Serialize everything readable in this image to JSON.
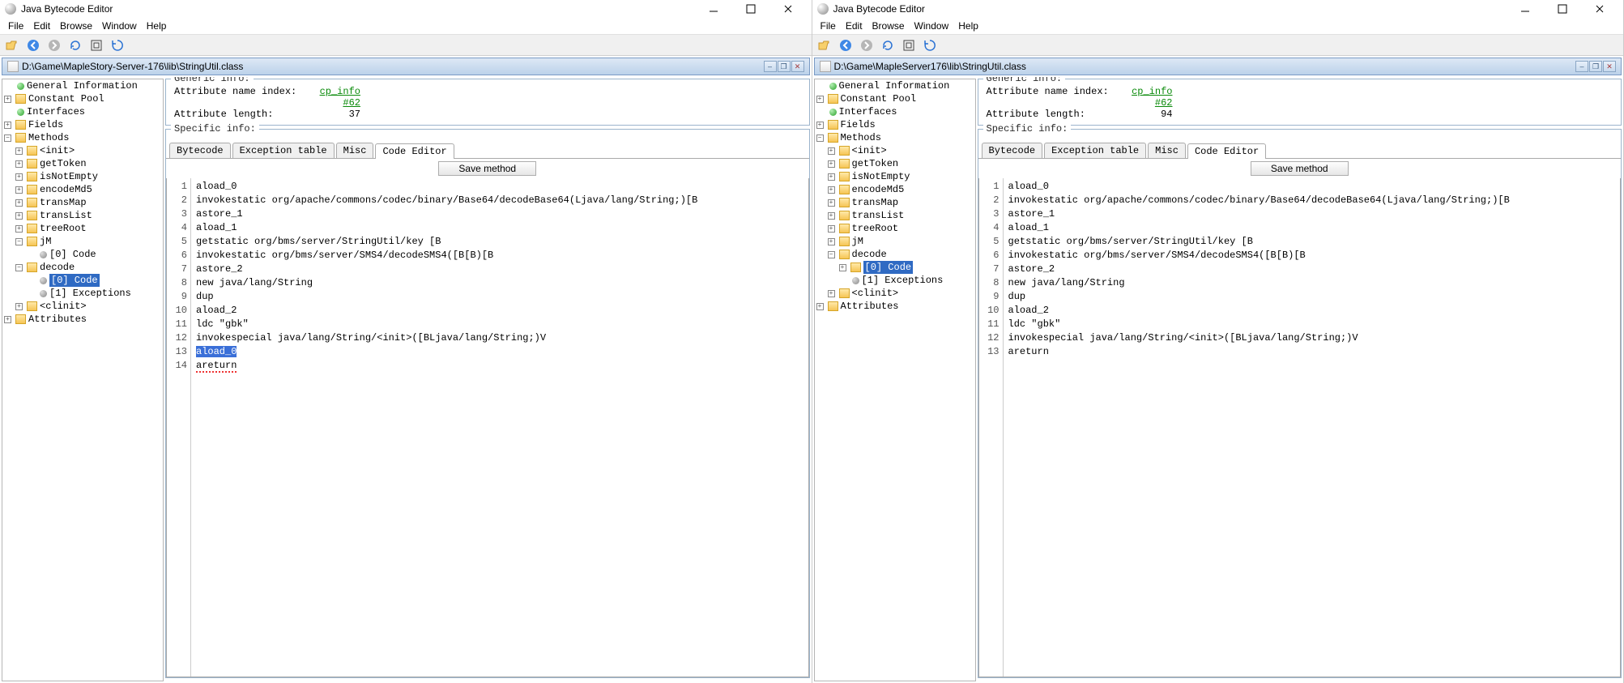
{
  "left": {
    "title": "Java Bytecode Editor",
    "menus": [
      "File",
      "Edit",
      "Browse",
      "Window",
      "Help"
    ],
    "mdi_path": "D:\\Game\\MapleStory-Server-176\\lib\\StringUtil.class",
    "generic_title": "Generic info:",
    "attr_name_idx_label": "Attribute name index:",
    "attr_name_idx_value": "cp_info #62",
    "attr_len_label": "Attribute length:",
    "attr_len_value": "37",
    "specific_title": "Specific info:",
    "tabs": [
      "Bytecode",
      "Exception table",
      "Misc",
      "Code Editor"
    ],
    "active_tab": 3,
    "save_label": "Save method",
    "tree": [
      {
        "label": "General Information",
        "icon": "dot-green",
        "twisty": "none"
      },
      {
        "label": "Constant Pool",
        "icon": "folder",
        "twisty": "plus"
      },
      {
        "label": "Interfaces",
        "icon": "dot-green",
        "twisty": "none"
      },
      {
        "label": "Fields",
        "icon": "folder",
        "twisty": "plus"
      },
      {
        "label": "Methods",
        "icon": "folder",
        "twisty": "minus",
        "children": [
          {
            "label": "<init>",
            "icon": "folder",
            "twisty": "plus"
          },
          {
            "label": "getToken",
            "icon": "folder",
            "twisty": "plus"
          },
          {
            "label": "isNotEmpty",
            "icon": "folder",
            "twisty": "plus"
          },
          {
            "label": "encodeMd5",
            "icon": "folder",
            "twisty": "plus"
          },
          {
            "label": "transMap",
            "icon": "folder",
            "twisty": "plus"
          },
          {
            "label": "transList",
            "icon": "folder",
            "twisty": "plus"
          },
          {
            "label": "treeRoot",
            "icon": "folder",
            "twisty": "plus"
          },
          {
            "label": "jM",
            "icon": "folder",
            "twisty": "minus",
            "children": [
              {
                "label": "[0] Code",
                "icon": "dot-gray",
                "twisty": "none"
              }
            ]
          },
          {
            "label": "decode",
            "icon": "folder",
            "twisty": "minus",
            "children": [
              {
                "label": "[0] Code",
                "icon": "dot-gray",
                "twisty": "none",
                "selected": true
              },
              {
                "label": "[1] Exceptions",
                "icon": "dot-gray",
                "twisty": "none"
              }
            ]
          },
          {
            "label": "<clinit>",
            "icon": "folder",
            "twisty": "plus"
          }
        ]
      },
      {
        "label": "Attributes",
        "icon": "folder",
        "twisty": "plus"
      }
    ],
    "code": [
      "aload_0",
      "invokestatic org/apache/commons/codec/binary/Base64/decodeBase64(Ljava/lang/String;)[B",
      "astore_1",
      "aload_1",
      "getstatic org/bms/server/StringUtil/key [B",
      "invokestatic org/bms/server/SMS4/decodeSMS4([B[B)[B",
      "astore_2",
      "new java/lang/String",
      "dup",
      "aload_2",
      "ldc \"gbk\"",
      "invokespecial java/lang/String/<init>([BLjava/lang/String;)V",
      "aload_0",
      "areturn"
    ],
    "selected_line_idx": 12,
    "error_tokens": [
      12,
      13
    ]
  },
  "right": {
    "title": "Java Bytecode Editor",
    "menus": [
      "File",
      "Edit",
      "Browse",
      "Window",
      "Help"
    ],
    "mdi_path": "D:\\Game\\MapleServer176\\lib\\StringUtil.class",
    "generic_title": "Generic info:",
    "attr_name_idx_label": "Attribute name index:",
    "attr_name_idx_value": "cp_info #62",
    "attr_len_label": "Attribute length:",
    "attr_len_value": "94",
    "specific_title": "Specific info:",
    "tabs": [
      "Bytecode",
      "Exception table",
      "Misc",
      "Code Editor"
    ],
    "active_tab": 3,
    "save_label": "Save method",
    "tree": [
      {
        "label": "General Information",
        "icon": "dot-green",
        "twisty": "none"
      },
      {
        "label": "Constant Pool",
        "icon": "folder",
        "twisty": "plus"
      },
      {
        "label": "Interfaces",
        "icon": "dot-green",
        "twisty": "none"
      },
      {
        "label": "Fields",
        "icon": "folder",
        "twisty": "plus"
      },
      {
        "label": "Methods",
        "icon": "folder",
        "twisty": "minus",
        "children": [
          {
            "label": "<init>",
            "icon": "folder",
            "twisty": "plus"
          },
          {
            "label": "getToken",
            "icon": "folder",
            "twisty": "plus"
          },
          {
            "label": "isNotEmpty",
            "icon": "folder",
            "twisty": "plus"
          },
          {
            "label": "encodeMd5",
            "icon": "folder",
            "twisty": "plus"
          },
          {
            "label": "transMap",
            "icon": "folder",
            "twisty": "plus"
          },
          {
            "label": "transList",
            "icon": "folder",
            "twisty": "plus"
          },
          {
            "label": "treeRoot",
            "icon": "folder",
            "twisty": "plus"
          },
          {
            "label": "jM",
            "icon": "folder",
            "twisty": "plus"
          },
          {
            "label": "decode",
            "icon": "folder",
            "twisty": "minus",
            "children": [
              {
                "label": "[0] Code",
                "icon": "folder",
                "twisty": "plus",
                "selected": true
              },
              {
                "label": "[1] Exceptions",
                "icon": "dot-gray",
                "twisty": "none"
              }
            ]
          },
          {
            "label": "<clinit>",
            "icon": "folder",
            "twisty": "plus"
          }
        ]
      },
      {
        "label": "Attributes",
        "icon": "folder",
        "twisty": "plus"
      }
    ],
    "code": [
      "aload_0",
      "invokestatic org/apache/commons/codec/binary/Base64/decodeBase64(Ljava/lang/String;)[B",
      "astore_1",
      "aload_1",
      "getstatic org/bms/server/StringUtil/key [B",
      "invokestatic org/bms/server/SMS4/decodeSMS4([B[B)[B",
      "astore_2",
      "new java/lang/String",
      "dup",
      "aload_2",
      "ldc \"gbk\"",
      "invokespecial java/lang/String/<init>([BLjava/lang/String;)V",
      "areturn"
    ],
    "cursor_line_idx": 12
  }
}
